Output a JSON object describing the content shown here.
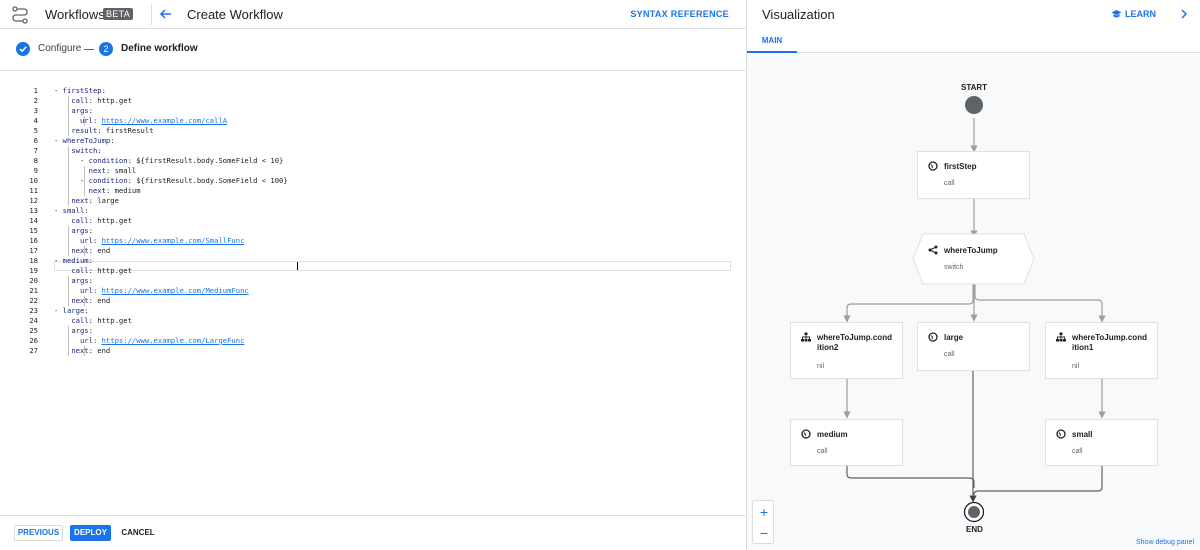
{
  "header": {
    "app_name": "Workflows",
    "badge": "BETA",
    "page_title": "Create Workflow",
    "syntax_reference": "SYNTAX REFERENCE"
  },
  "stepper": {
    "step1_label": "Configure",
    "step2_number": "2",
    "step2_label": "Define workflow"
  },
  "editor": {
    "lines": [
      {
        "n": "1",
        "text": "- firstStep:"
      },
      {
        "n": "2",
        "text": "    call: http.get"
      },
      {
        "n": "3",
        "text": "    args:"
      },
      {
        "n": "4",
        "text": "      url: https://www.example.com/callA"
      },
      {
        "n": "5",
        "text": "    result: firstResult"
      },
      {
        "n": "6",
        "text": "- whereToJump:"
      },
      {
        "n": "7",
        "text": "    switch:"
      },
      {
        "n": "8",
        "text": "      - condition: ${firstResult.body.SomeField < 10}"
      },
      {
        "n": "9",
        "text": "        next: small"
      },
      {
        "n": "10",
        "text": "      - condition: ${firstResult.body.SomeField < 100}"
      },
      {
        "n": "11",
        "text": "        next: medium"
      },
      {
        "n": "12",
        "text": "    next: large"
      },
      {
        "n": "13",
        "text": "- small:"
      },
      {
        "n": "14",
        "text": "    call: http.get"
      },
      {
        "n": "15",
        "text": "    args:"
      },
      {
        "n": "16",
        "text": "      url: https://www.example.com/SmallFunc"
      },
      {
        "n": "17",
        "text": "    next: end"
      },
      {
        "n": "18",
        "text": "- medium:"
      },
      {
        "n": "19",
        "text": "    call: http.get"
      },
      {
        "n": "20",
        "text": "    args:"
      },
      {
        "n": "21",
        "text": "      url: https://www.example.com/MediumFunc"
      },
      {
        "n": "22",
        "text": "    next: end"
      },
      {
        "n": "23",
        "text": "- large:"
      },
      {
        "n": "24",
        "text": "    call: http.get"
      },
      {
        "n": "25",
        "text": "    args:"
      },
      {
        "n": "26",
        "text": "      url: https://www.example.com/LargeFunc"
      },
      {
        "n": "27",
        "text": "    next: end"
      }
    ]
  },
  "footer": {
    "previous": "PREVIOUS",
    "deploy": "DEPLOY",
    "cancel": "CANCEL"
  },
  "visualization": {
    "title": "Visualization",
    "learn": "LEARN",
    "tab_main": "MAIN",
    "start": "START",
    "end": "END",
    "zoom_in": "+",
    "zoom_out": "−",
    "debug_link": "Show debug panel",
    "nodes": {
      "firstStep": {
        "name": "firstStep",
        "sub": "call"
      },
      "whereToJump": {
        "name": "whereToJump",
        "sub": "switch"
      },
      "cond2": {
        "name": "whereToJump.condition2",
        "sub": "nil"
      },
      "large": {
        "name": "large",
        "sub": "call"
      },
      "cond1": {
        "name": "whereToJump.condition1",
        "sub": "nil"
      },
      "medium": {
        "name": "medium",
        "sub": "call"
      },
      "small": {
        "name": "small",
        "sub": "call"
      }
    }
  },
  "colors": {
    "accent": "#1a73e8",
    "node_border": "#e0e0e0",
    "edge": "#9e9e9e",
    "start_fill": "#5f6368"
  }
}
